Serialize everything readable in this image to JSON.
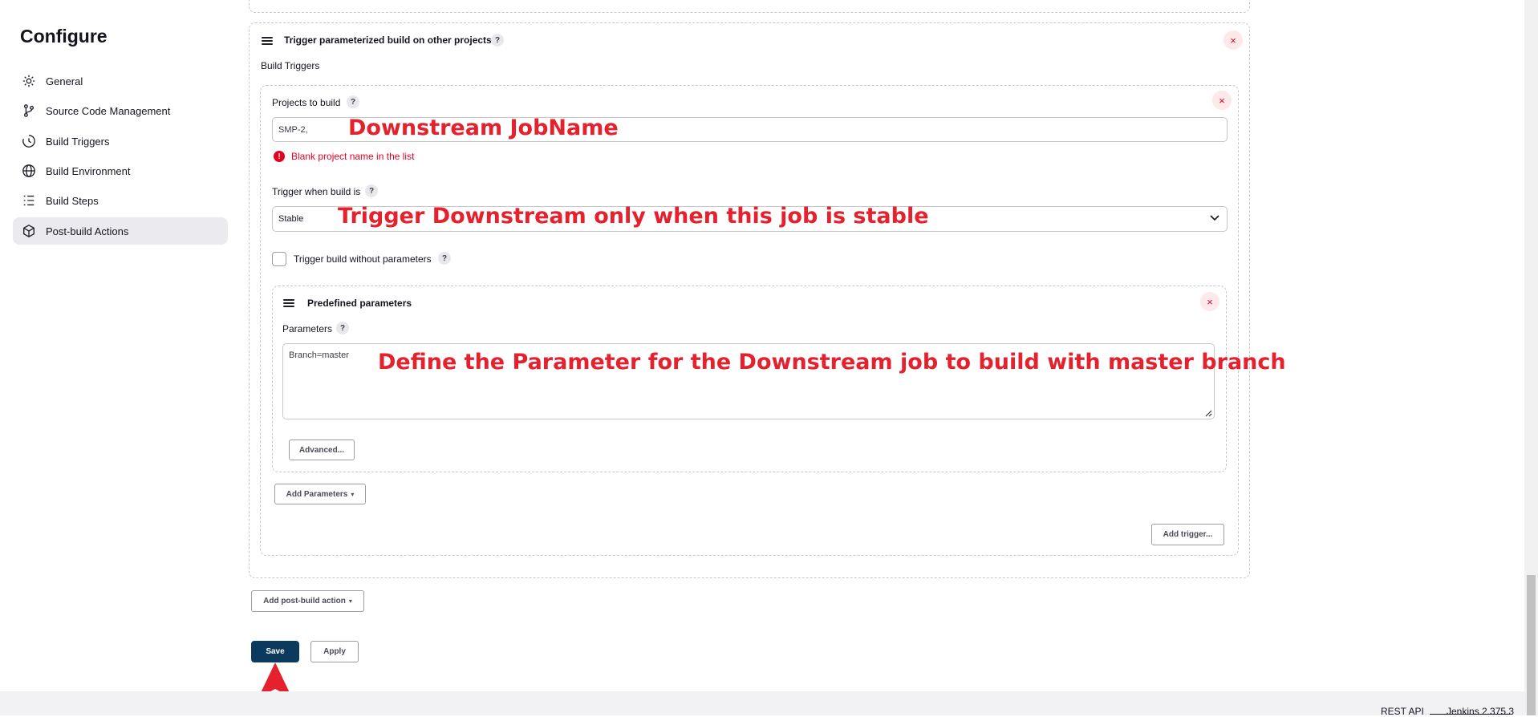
{
  "sidebar": {
    "title": "Configure",
    "items": [
      {
        "label": "General",
        "icon": "gear-icon"
      },
      {
        "label": "Source Code Management",
        "icon": "branch-icon"
      },
      {
        "label": "Build Triggers",
        "icon": "clock-icon"
      },
      {
        "label": "Build Environment",
        "icon": "globe-icon"
      },
      {
        "label": "Build Steps",
        "icon": "list-icon"
      },
      {
        "label": "Post-build Actions",
        "icon": "cube-icon",
        "active": true
      }
    ]
  },
  "trigger_section": {
    "title": "Trigger parameterized build on other projects",
    "build_triggers_label": "Build Triggers",
    "projects_to_build": {
      "label": "Projects to build",
      "value": "SMP-2,",
      "error": "Blank project name in the list"
    },
    "trigger_when": {
      "label": "Trigger when build is",
      "selected": "Stable"
    },
    "trigger_without_params": {
      "label": "Trigger build without parameters",
      "checked": false
    },
    "predefined": {
      "title": "Predefined parameters",
      "params_label": "Parameters",
      "params_value": "Branch=master",
      "advanced_label": "Advanced..."
    },
    "add_parameters_label": "Add Parameters",
    "add_trigger_label": "Add trigger...",
    "help_glyph": "?",
    "close_glyph": "×"
  },
  "actions": {
    "add_post_build_label": "Add post-build action",
    "save_label": "Save",
    "apply_label": "Apply"
  },
  "annotations": {
    "downstream_jobname": "Downstream JobName",
    "trigger_stable": "Trigger Downstream only when this job is stable",
    "define_parameter": "Define the Parameter for the Downstream job to build with master branch",
    "arrow_color": "#e4212d"
  },
  "footer": {
    "rest_api": "REST API",
    "version": "Jenkins 2.375.3"
  },
  "colors": {
    "primary_button": "#0b3a5e",
    "error": "#e6001f",
    "annotation": "#e4212d",
    "active_sidebar": "#ebebef"
  }
}
